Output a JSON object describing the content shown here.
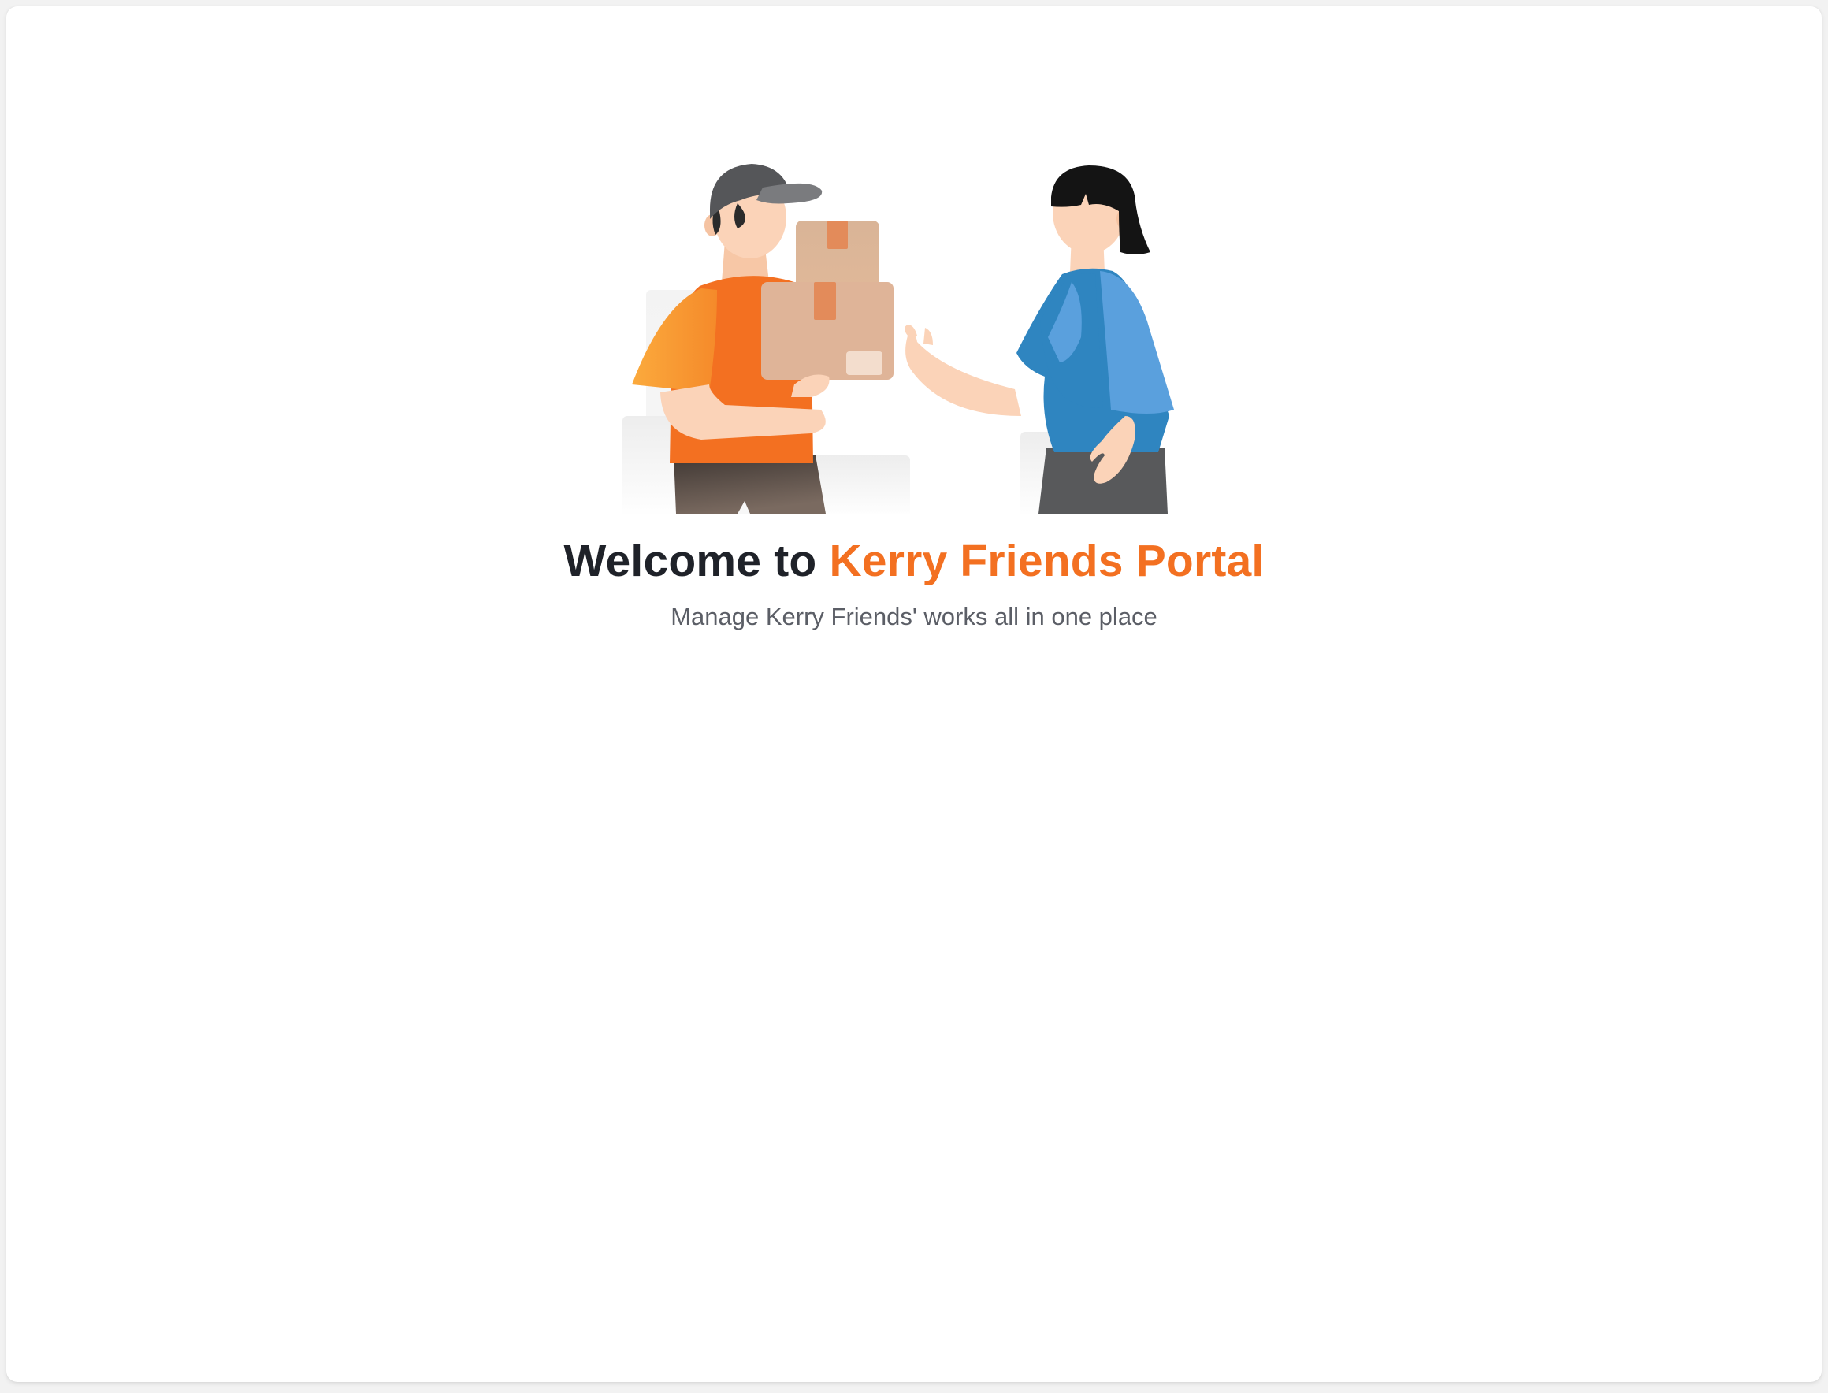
{
  "welcome": {
    "headline_prefix": "Welcome to",
    "headline_brand": "Kerry Friends Portal",
    "subtitle": "Manage Kerry Friends' works all in one place",
    "illustration_icon": "delivery-handoff-illustration"
  },
  "colors": {
    "brand_orange": "#f37021",
    "heading_dark": "#1f2229",
    "subtitle_gray": "#5b5e66",
    "shirt_blue": "#5aa0dd",
    "box_tan": "#ddb090"
  }
}
